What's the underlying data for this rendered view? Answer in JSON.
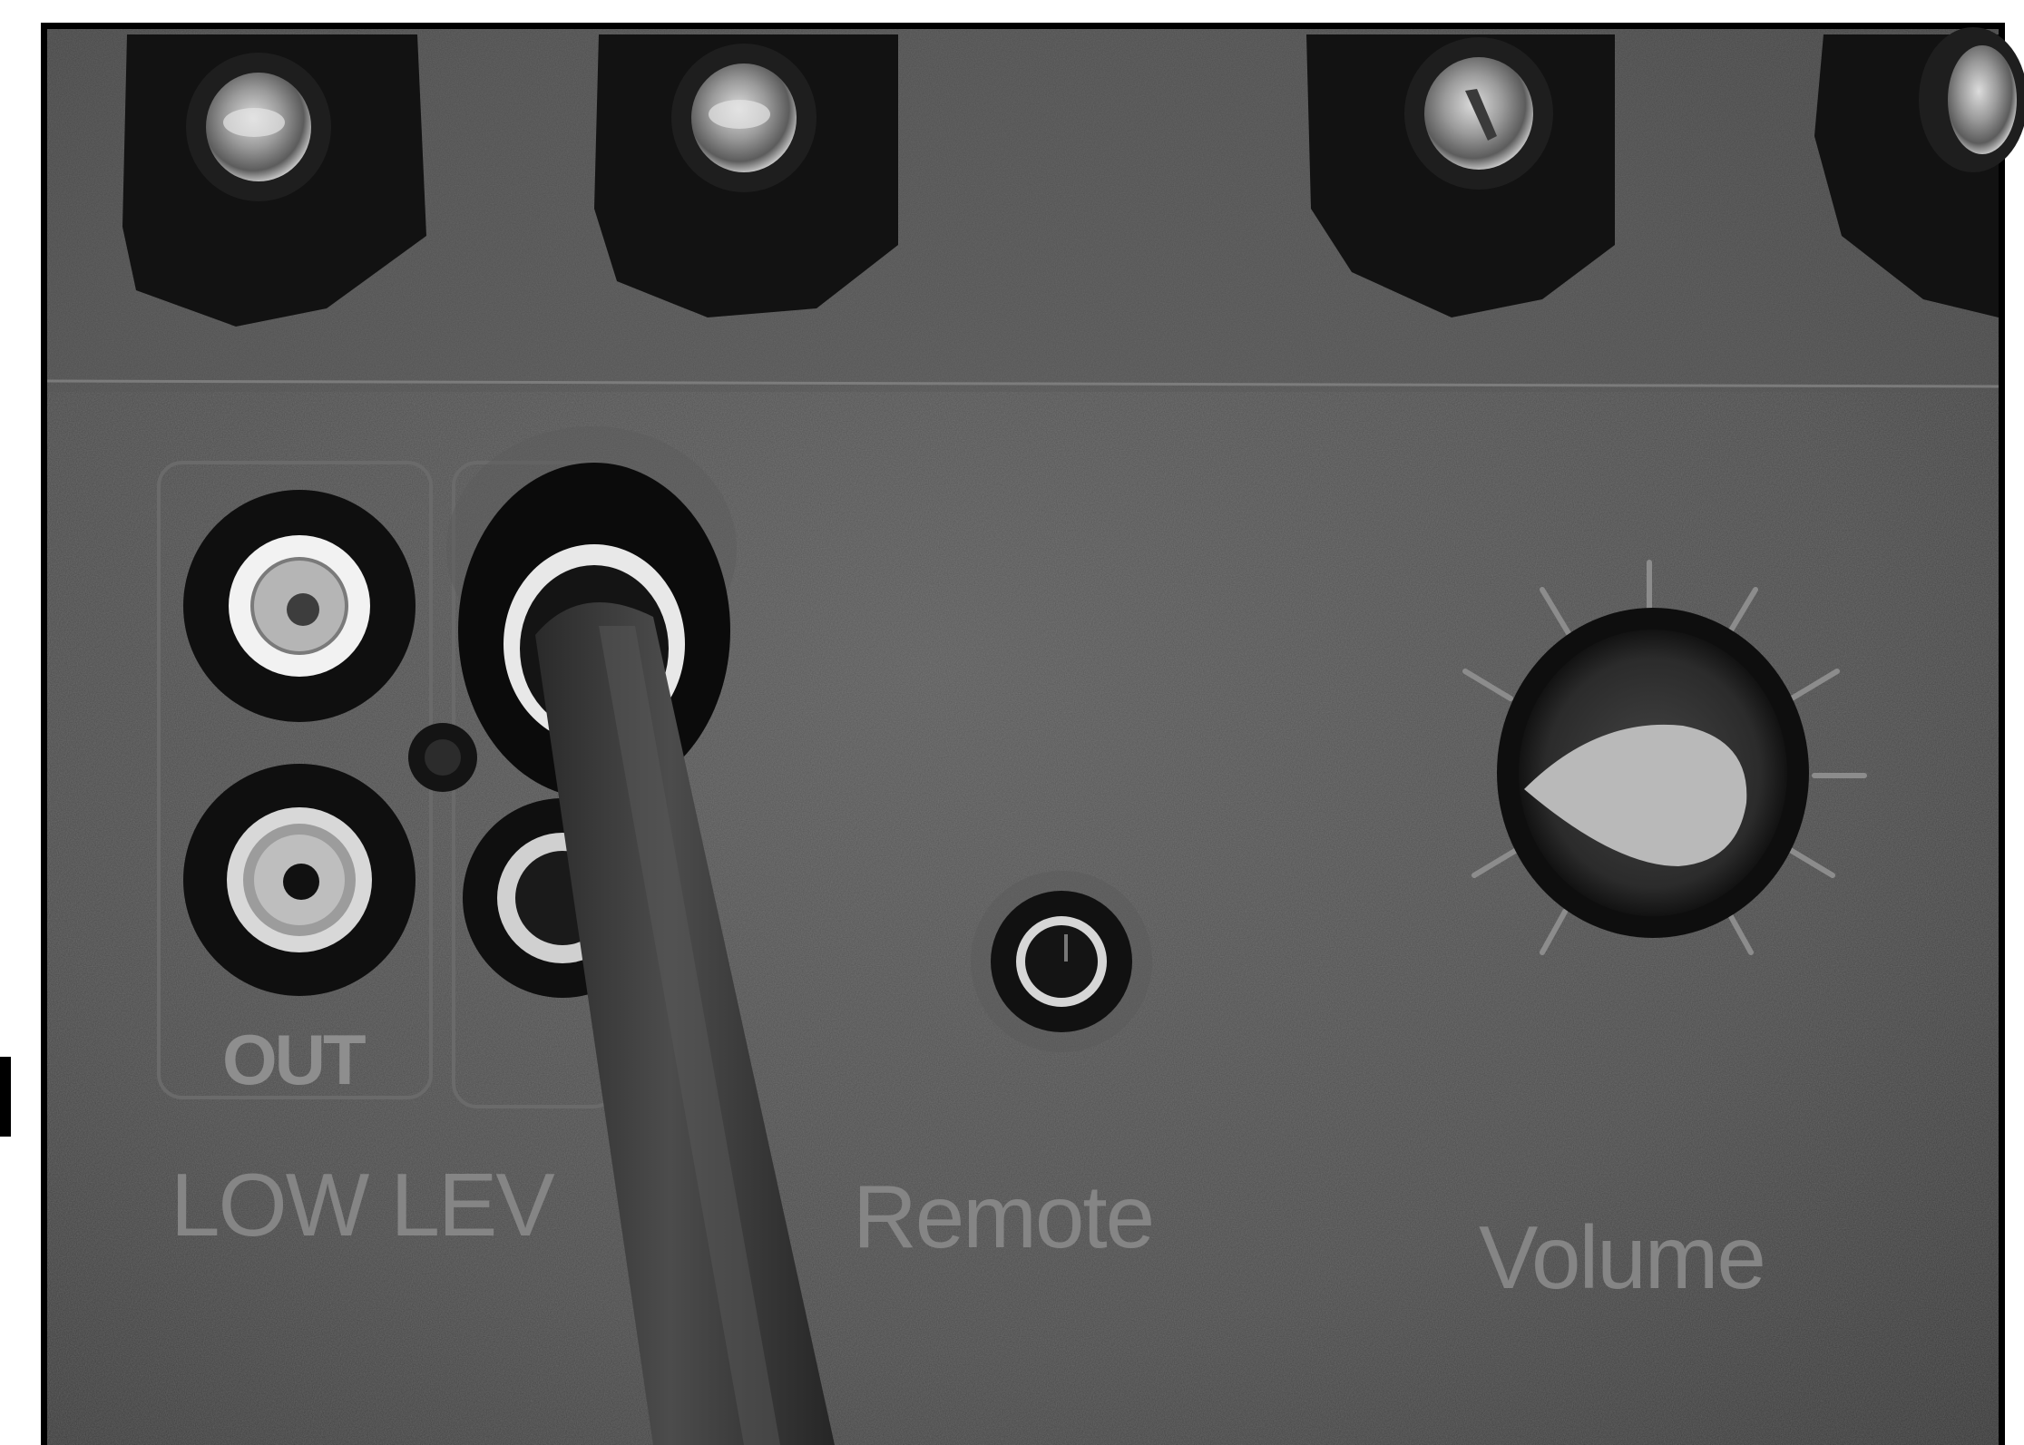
{
  "photo": {
    "labels": {
      "out": "OUT",
      "low_level": "LOW LEV",
      "remote": "Remote",
      "volume": "Volume"
    },
    "colors": {
      "panel": "#4a4a4a",
      "panel_dark": "#2e2e2e",
      "label": "#878787",
      "cable": "#3a3a3a",
      "knob_pointer": "#b9b9b9",
      "frame": "#000000"
    },
    "items": [
      {
        "name": "speaker-binding-post-1"
      },
      {
        "name": "speaker-binding-post-2"
      },
      {
        "name": "speaker-binding-post-3"
      },
      {
        "name": "speaker-binding-post-4"
      },
      {
        "name": "rca-jack-out-top"
      },
      {
        "name": "rca-jack-out-bottom"
      },
      {
        "name": "rca-cable-plug"
      },
      {
        "name": "remote-jack"
      },
      {
        "name": "volume-knob"
      }
    ]
  }
}
